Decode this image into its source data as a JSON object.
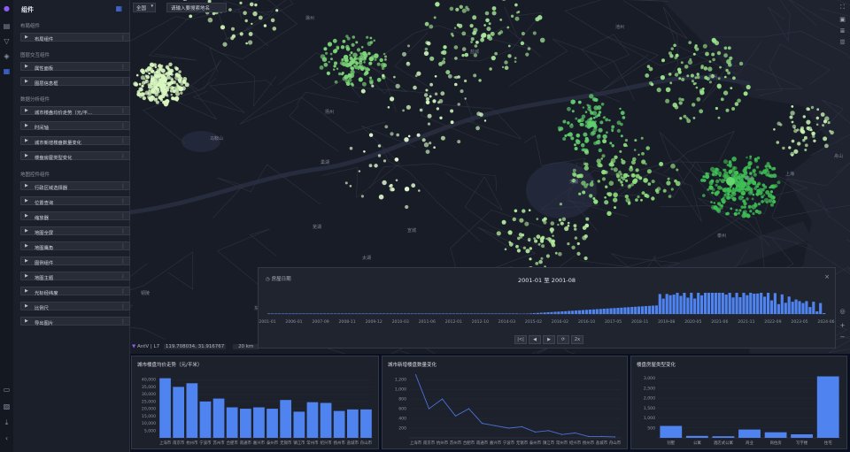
{
  "sidebar": {
    "title": "组件",
    "sections": [
      {
        "label": "布局组件",
        "items": [
          "布局组件"
        ]
      },
      {
        "label": "图层交互组件",
        "items": [
          "属性面板",
          "图层信息框"
        ]
      },
      {
        "label": "数据分析组件",
        "items": [
          "城市楼盘均价走势（元/平...",
          "时间轴",
          "城市新增楼盘数量变化",
          "楼盘房屋类型变化"
        ]
      },
      {
        "label": "地图控件组件",
        "items": [
          "行政区域选择器",
          "位置查询",
          "缩放器",
          "地图全屏",
          "地图鹰角",
          "图例组件",
          "地图主题",
          "光标经纬度",
          "比例尺",
          "导出图片"
        ]
      }
    ]
  },
  "map": {
    "region_select": "全国",
    "search_placeholder": "请输入要搜索地名",
    "coords": "119.708034, 31.916767",
    "scale": "20 km",
    "logo": "AntV | L7",
    "places": [
      "滁州",
      "盐城",
      "扬州",
      "马鞍山",
      "巢湖",
      "芜湖",
      "无锡",
      "太湖",
      "宣城",
      "铜陵",
      "池州",
      "嘉兴",
      "泰州",
      "南通",
      "上海",
      "舟山",
      "杭州",
      "黄山",
      "景德镇",
      "东营"
    ]
  },
  "timeline": {
    "label": "房屋日期",
    "title": "2001-01 至 2001-08",
    "ticks": [
      "2001-01",
      "2006-01",
      "2007-09",
      "2008-11",
      "2009-12",
      "2010-03",
      "2011-06",
      "2012-01",
      "2012-10",
      "2014-03",
      "2015-02",
      "2016-02",
      "2016-10",
      "2017-05",
      "2018-11",
      "2019-08",
      "2020-05",
      "2021-06",
      "2021-11",
      "2022-09",
      "2023-05",
      "2024-06"
    ],
    "buttons": [
      "|<|",
      "◀",
      "▶",
      "⟳",
      "2x"
    ]
  },
  "colors": {
    "bar": "#4f84f0",
    "line": "#4a72d6",
    "accent": "#4b7bff"
  },
  "chart_data": [
    {
      "type": "bar",
      "title": "城市楼盘均价走势（元/平米）",
      "categories": [
        "上海市",
        "南京市",
        "杭州市",
        "宁波市",
        "苏州市",
        "合肥市",
        "南通市",
        "嘉兴市",
        "泰州市",
        "无锡市",
        "镇江市",
        "常州市",
        "绍兴市",
        "扬州市",
        "盐城市",
        "舟山市"
      ],
      "values": [
        41000,
        35000,
        37500,
        25000,
        27000,
        21000,
        20000,
        21000,
        20000,
        26000,
        18000,
        24500,
        24000,
        18500,
        19500,
        19500
      ],
      "yticks": [
        "5,000",
        "10,000",
        "15,000",
        "20,000",
        "25,000",
        "30,000",
        "35,000",
        "40,000"
      ],
      "ylim": [
        0,
        45000
      ]
    },
    {
      "type": "line",
      "title": "城市新增楼盘数量变化",
      "categories": [
        "上海市",
        "南京市",
        "杭州市",
        "苏州市",
        "合肥市",
        "南通市",
        "嘉兴市",
        "宁波市",
        "无锡市",
        "泰州市",
        "镇江市",
        "常州市",
        "绍兴市",
        "扬州市",
        "盐城市",
        "舟山市"
      ],
      "values": [
        1300,
        600,
        800,
        450,
        600,
        300,
        250,
        200,
        230,
        120,
        150,
        70,
        100,
        30,
        30,
        20
      ],
      "yticks": [
        "200",
        "400",
        "600",
        "800",
        "1,000",
        "1,200"
      ],
      "ylim": [
        0,
        1350
      ]
    },
    {
      "type": "bar",
      "title": "楼盘房屋类型变化",
      "categories": [
        "别墅",
        "公寓",
        "酒店式公寓",
        "商业",
        "商住房",
        "写字楼",
        "住宅"
      ],
      "values": [
        600,
        100,
        80,
        420,
        280,
        180,
        3100
      ],
      "yticks": [
        "500",
        "1,000",
        "1,500",
        "2,000",
        "2,500",
        "3,000"
      ],
      "ylim": [
        0,
        3300
      ]
    }
  ]
}
